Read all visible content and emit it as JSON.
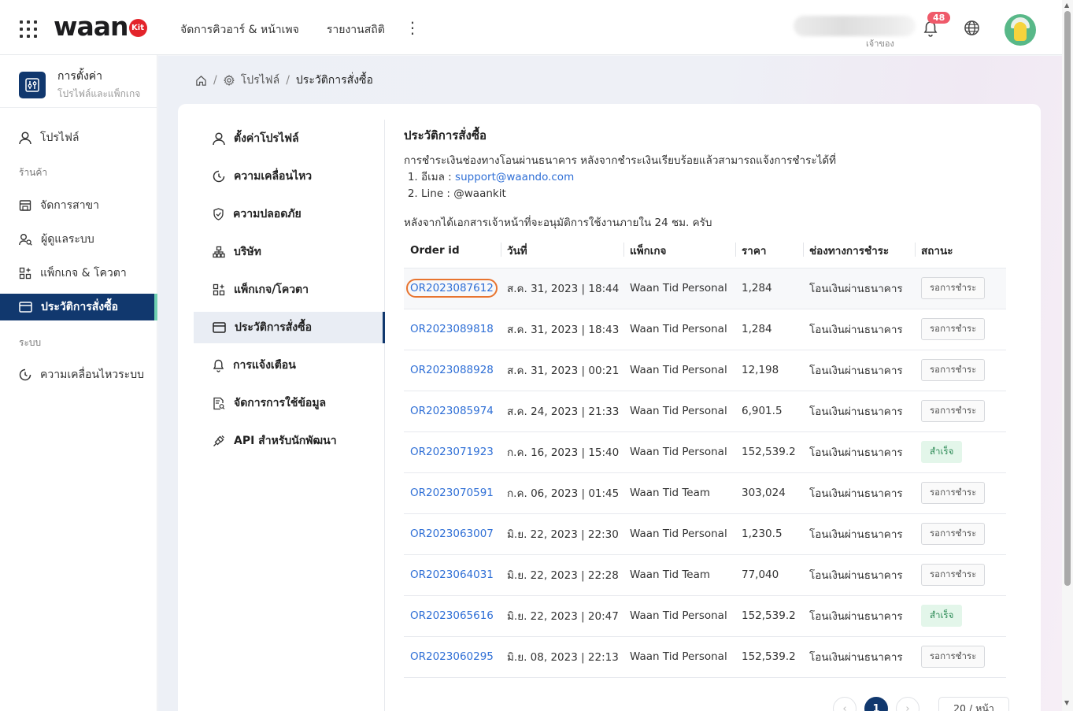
{
  "header": {
    "logo_text": "waan",
    "logo_badge": "Kit",
    "nav": [
      "จัดการคิวอาร์ & หน้าเพจ",
      "รายงานสถิติ"
    ],
    "more": "⋮",
    "user_role": "เจ้าของ",
    "notification_count": "48"
  },
  "sidebar": {
    "title": "การตั้งค่า",
    "subtitle": "โปรไฟล์และแพ็กเกจ",
    "profile": "โปรไฟล์",
    "section_shop": "ร้านค้า",
    "shop_items": [
      "จัดการสาขา",
      "ผู้ดูแลระบบ",
      "แพ็กเกจ & โควตา",
      "ประวัติการสั่งซื้อ"
    ],
    "section_system": "ระบบ",
    "system_items": [
      "ความเคลื่อนไหวระบบ"
    ]
  },
  "breadcrumb": {
    "sep": "/",
    "profile": "โปรไฟล์",
    "current": "ประวัติการสั่งซื้อ"
  },
  "subnav": [
    "ตั้งค่าโปรไฟล์",
    "ความเคลื่อนไหว",
    "ความปลอดภัย",
    "บริษัท",
    "แพ็กเกจ/โควตา",
    "ประวัติการสั่งซื้อ",
    "การแจ้งเตือน",
    "จัดการการใช้ข้อมูล",
    "API สำหรับนักพัฒนา"
  ],
  "content": {
    "title": "ประวัติการสั่งซื้อ",
    "description": "การชำระเงินช่องทางโอนผ่านธนาคาร หลังจากชำระเงินเรียบร้อยแล้วสามารถแจ้งการชำระได้ที่",
    "contact_email_label": "อีเมล : ",
    "contact_email": "support@waando.com",
    "contact_line": "Line : @waankit",
    "note": "หลังจากได้เอกสารเจ้าหน้าที่จะอนุมัติการใช้งานภายใน 24 ชม. ครับ"
  },
  "table": {
    "headers": [
      "Order id",
      "วันที่",
      "แพ็กเกจ",
      "ราคา",
      "ช่องทางการชำระ",
      "สถานะ"
    ],
    "rows": [
      {
        "id": "OR2023087612",
        "date": "ส.ค. 31, 2023 | 18:44",
        "package": "Waan Tid Personal",
        "price": "1,284",
        "method": "โอนเงินผ่านธนาคาร",
        "status": "รอการชำระ",
        "state": "pending"
      },
      {
        "id": "OR2023089818",
        "date": "ส.ค. 31, 2023 | 18:43",
        "package": "Waan Tid Personal",
        "price": "1,284",
        "method": "โอนเงินผ่านธนาคาร",
        "status": "รอการชำระ",
        "state": "pending"
      },
      {
        "id": "OR2023088928",
        "date": "ส.ค. 31, 2023 | 00:21",
        "package": "Waan Tid Personal",
        "price": "12,198",
        "method": "โอนเงินผ่านธนาคาร",
        "status": "รอการชำระ",
        "state": "pending"
      },
      {
        "id": "OR2023085974",
        "date": "ส.ค. 24, 2023 | 21:33",
        "package": "Waan Tid Personal",
        "price": "6,901.5",
        "method": "โอนเงินผ่านธนาคาร",
        "status": "รอการชำระ",
        "state": "pending"
      },
      {
        "id": "OR2023071923",
        "date": "ก.ค. 16, 2023 | 15:40",
        "package": "Waan Tid Personal",
        "price": "152,539.2",
        "method": "โอนเงินผ่านธนาคาร",
        "status": "สำเร็จ",
        "state": "success"
      },
      {
        "id": "OR2023070591",
        "date": "ก.ค. 06, 2023 | 01:45",
        "package": "Waan Tid Team",
        "price": "303,024",
        "method": "โอนเงินผ่านธนาคาร",
        "status": "รอการชำระ",
        "state": "pending"
      },
      {
        "id": "OR2023063007",
        "date": "มิ.ย. 22, 2023 | 22:30",
        "package": "Waan Tid Personal",
        "price": "1,230.5",
        "method": "โอนเงินผ่านธนาคาร",
        "status": "รอการชำระ",
        "state": "pending"
      },
      {
        "id": "OR2023064031",
        "date": "มิ.ย. 22, 2023 | 22:28",
        "package": "Waan Tid Team",
        "price": "77,040",
        "method": "โอนเงินผ่านธนาคาร",
        "status": "รอการชำระ",
        "state": "pending"
      },
      {
        "id": "OR2023065616",
        "date": "มิ.ย. 22, 2023 | 20:47",
        "package": "Waan Tid Personal",
        "price": "152,539.2",
        "method": "โอนเงินผ่านธนาคาร",
        "status": "สำเร็จ",
        "state": "success"
      },
      {
        "id": "OR2023060295",
        "date": "มิ.ย. 08, 2023 | 22:13",
        "package": "Waan Tid Personal",
        "price": "152,539.2",
        "method": "โอนเงินผ่านธนาคาร",
        "status": "รอการชำระ",
        "state": "pending"
      }
    ]
  },
  "pagination": {
    "prev": "‹",
    "current_page": "1",
    "next": "›",
    "page_size": "20 / หน้า"
  },
  "colors": {
    "primary": "#11386e",
    "link": "#2f6fd6",
    "highlight": "#e8742f",
    "success": "#2e8b57"
  }
}
